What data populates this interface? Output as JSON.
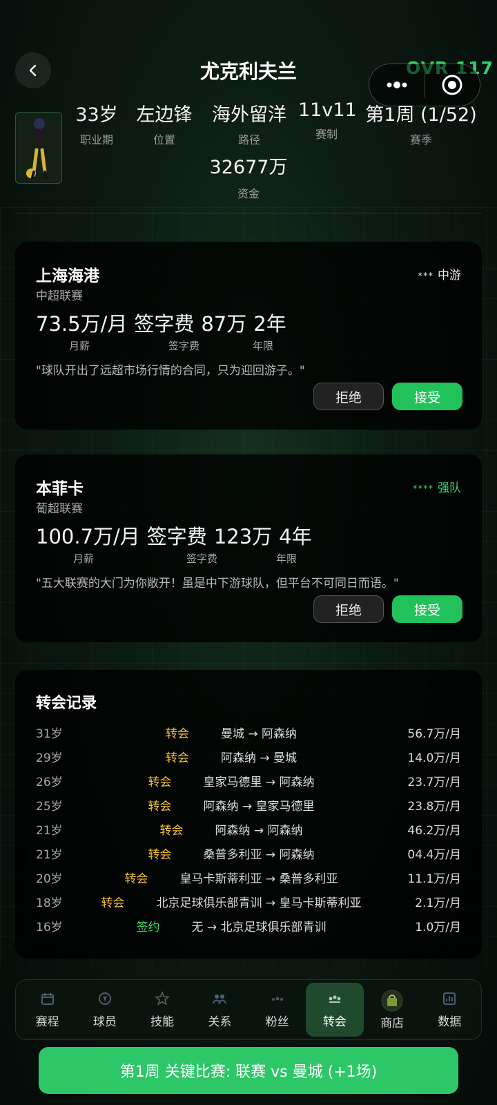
{
  "header": {
    "title": "尤克利夫兰",
    "ovr": "OVR 117",
    "stats": [
      {
        "value": "33岁",
        "label": "职业期"
      },
      {
        "value": "左边锋",
        "label": "位置"
      },
      {
        "value": "海外留洋",
        "label": "路径"
      },
      {
        "value": "11v11",
        "label": "赛制"
      },
      {
        "value": "第1周 (1/52)",
        "label": "赛季"
      }
    ],
    "funds": {
      "value": "32677万",
      "label": "资金"
    }
  },
  "offers": [
    {
      "club": "上海海港",
      "league": "中超联赛",
      "stars": "***",
      "tier": "中游",
      "wage": "73.5万/月",
      "fee_prefix": "签字费",
      "fee": "87万",
      "years": "2年",
      "labels": {
        "wage": "月薪",
        "fee": "签字费",
        "years": "年限"
      },
      "quote": "\"球队开出了远超市场行情的合同，只为迎回游子。\"",
      "reject": "拒绝",
      "accept": "接受"
    },
    {
      "club": "本菲卡",
      "league": "葡超联赛",
      "stars": "****",
      "tier": "强队",
      "wage": "100.7万/月",
      "fee_prefix": "签字费",
      "fee": "123万",
      "years": "4年",
      "labels": {
        "wage": "月薪",
        "fee": "签字费",
        "years": "年限"
      },
      "quote": "\"五大联赛的大门为你敞开！虽是中下游球队，但平台不可同日而语。\"",
      "reject": "拒绝",
      "accept": "接受"
    }
  ],
  "history": {
    "title": "转会记录",
    "rows": [
      {
        "age": "31岁",
        "kind": "转会",
        "route": "曼城 → 阿森纳",
        "salary": "56.7万/月"
      },
      {
        "age": "29岁",
        "kind": "转会",
        "route": "阿森纳 → 曼城",
        "salary": "14.0万/月"
      },
      {
        "age": "26岁",
        "kind": "转会",
        "route": "皇家马德里 → 阿森纳",
        "salary": "23.7万/月"
      },
      {
        "age": "25岁",
        "kind": "转会",
        "route": "阿森纳 → 皇家马德里",
        "salary": "23.8万/月"
      },
      {
        "age": "21岁",
        "kind": "转会",
        "route": "阿森纳 → 阿森纳",
        "salary": "46.2万/月"
      },
      {
        "age": "21岁",
        "kind": "转会",
        "route": "桑普多利亚 → 阿森纳",
        "salary": "04.4万/月"
      },
      {
        "age": "20岁",
        "kind": "转会",
        "route": "皇马卡斯蒂利亚 → 桑普多利亚",
        "salary": "11.1万/月"
      },
      {
        "age": "18岁",
        "kind": "转会",
        "route": "北京足球俱乐部青训 → 皇马卡斯蒂利亚",
        "salary": "2.1万/月"
      },
      {
        "age": "16岁",
        "kind": "签约",
        "route": "无 → 北京足球俱乐部青训",
        "salary": "1.0万/月"
      }
    ]
  },
  "nav": {
    "items": [
      {
        "label": "赛程",
        "icon": "calendar-icon"
      },
      {
        "label": "球员",
        "icon": "badge-icon"
      },
      {
        "label": "技能",
        "icon": "star-icon"
      },
      {
        "label": "关系",
        "icon": "people-icon"
      },
      {
        "label": "粉丝",
        "icon": "fans-icon"
      },
      {
        "label": "转会",
        "icon": "transfer-icon"
      },
      {
        "label": "商店",
        "icon": "shop-icon"
      },
      {
        "label": "数据",
        "icon": "chart-icon"
      }
    ],
    "active": "转会"
  },
  "cta": {
    "label": "第1周 关键比赛: 联赛 vs 曼城 (+1场)"
  },
  "colors": {
    "accent": "#2dc768",
    "gold": "#f4c133",
    "card": "#000000"
  }
}
